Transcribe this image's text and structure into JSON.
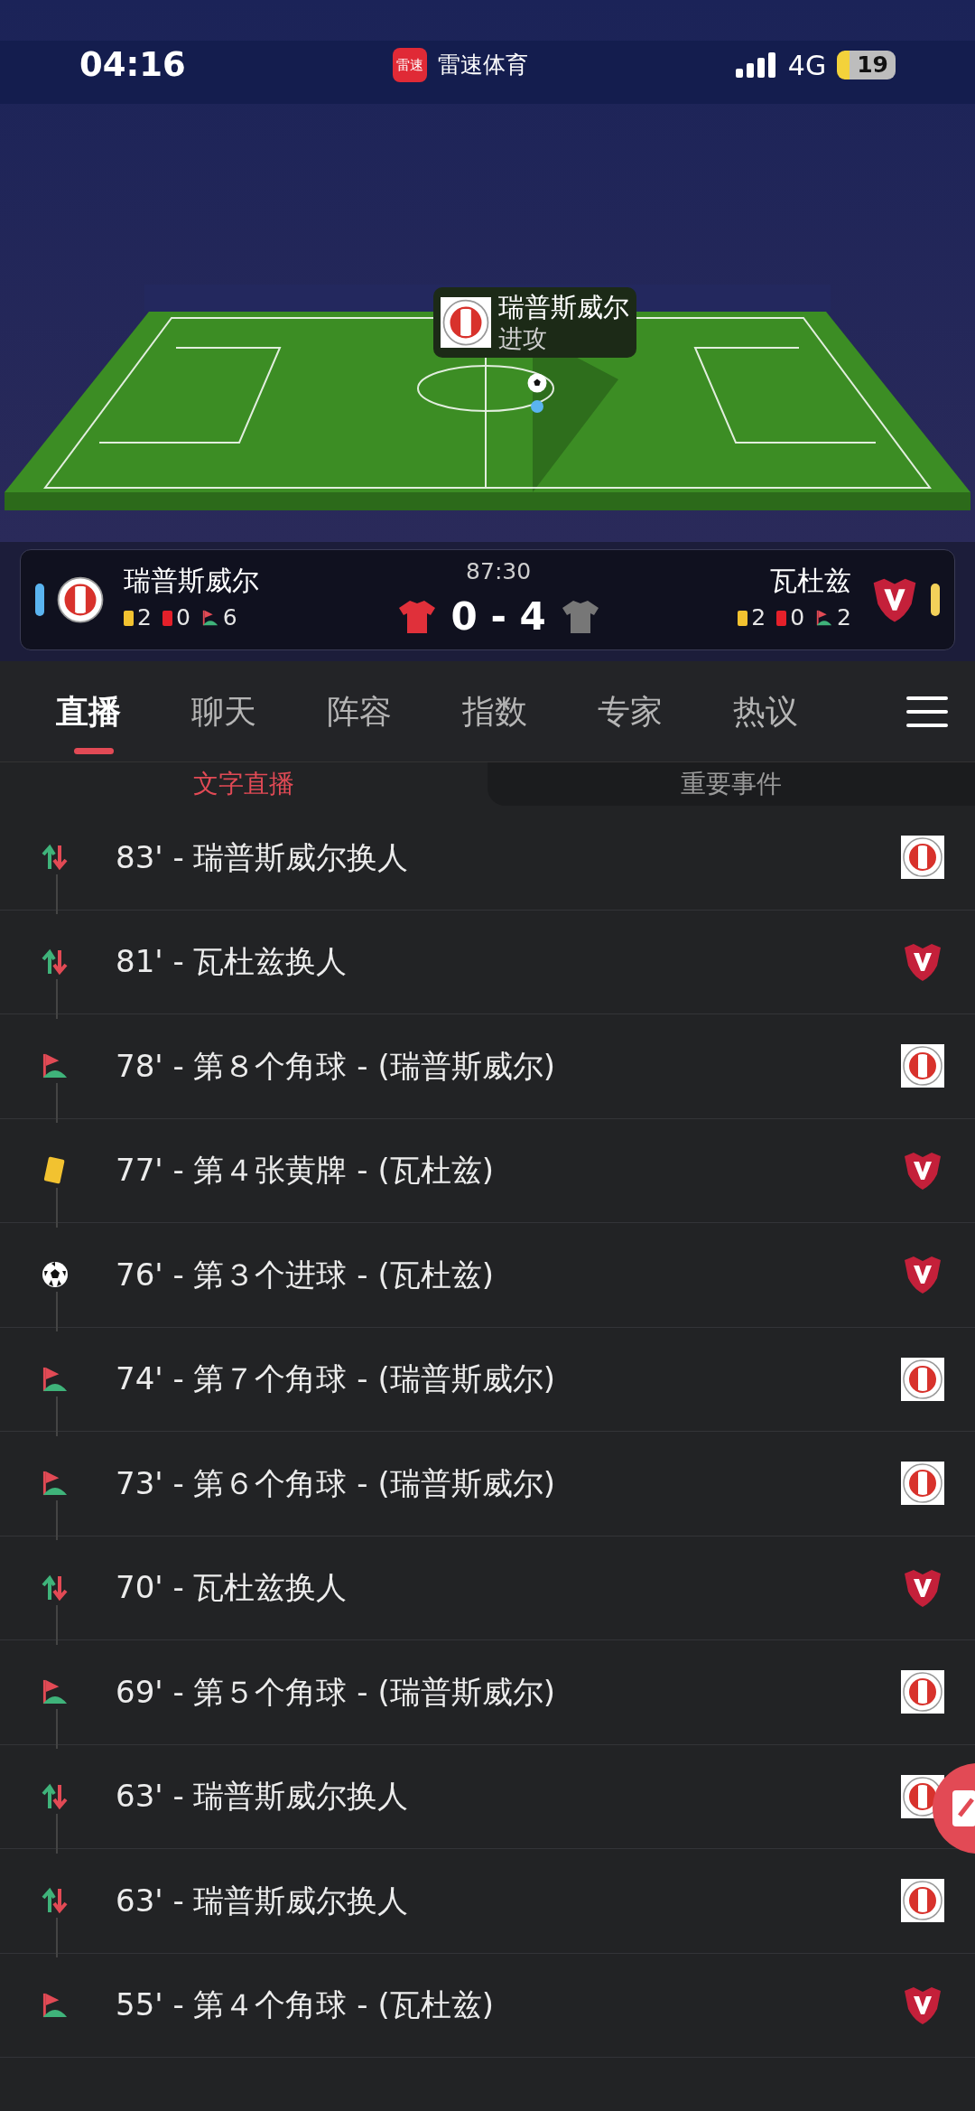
{
  "status_bar": {
    "time": "04:16",
    "app_logo": "雷速",
    "app_name": "雷速体育",
    "network": "4G",
    "battery": "19"
  },
  "pitch_overlay": {
    "team": "瑞普斯威尔",
    "action": "进攻"
  },
  "scoreboard": {
    "clock": "87:30",
    "score": "0 - 4",
    "home": {
      "name": "瑞普斯威尔",
      "color": "#5ab4f0",
      "yellow": "2",
      "red": "0",
      "corners": "6"
    },
    "away": {
      "name": "瓦杜兹",
      "color": "#f3d15a",
      "yellow": "2",
      "red": "0",
      "corners": "2"
    }
  },
  "tabs": [
    {
      "label": "直播",
      "selected": true
    },
    {
      "label": "聊天",
      "selected": false
    },
    {
      "label": "阵容",
      "selected": false
    },
    {
      "label": "指数",
      "selected": false
    },
    {
      "label": "专家",
      "selected": false
    },
    {
      "label": "热议",
      "selected": false
    }
  ],
  "subtabs": [
    {
      "label": "文字直播",
      "selected": true
    },
    {
      "label": "重要事件",
      "selected": false
    }
  ],
  "events": [
    {
      "kind": "sub",
      "text": "83' - 瑞普斯威尔换人",
      "badge": {
        "kind": "home"
      }
    },
    {
      "kind": "sub",
      "text": "81' - 瓦杜兹换人",
      "badge": {
        "kind": "away"
      }
    },
    {
      "kind": "corner",
      "text": "78' - 第８个角球 - (瑞普斯威尔)",
      "badge": {
        "kind": "home"
      }
    },
    {
      "kind": "yellow",
      "text": "77' - 第４张黄牌 - (瓦杜兹)",
      "badge": {
        "kind": "away"
      }
    },
    {
      "kind": "goal",
      "text": "76' - 第３个进球 - (瓦杜兹)",
      "badge": {
        "kind": "away"
      }
    },
    {
      "kind": "corner",
      "text": "74' - 第７个角球 - (瑞普斯威尔)",
      "badge": {
        "kind": "home"
      }
    },
    {
      "kind": "corner",
      "text": "73' - 第６个角球 - (瑞普斯威尔)",
      "badge": {
        "kind": "home"
      }
    },
    {
      "kind": "sub",
      "text": "70' - 瓦杜兹换人",
      "badge": {
        "kind": "away"
      }
    },
    {
      "kind": "corner",
      "text": "69' - 第５个角球 - (瑞普斯威尔)",
      "badge": {
        "kind": "home"
      }
    },
    {
      "kind": "sub",
      "text": "63' - 瑞普斯威尔换人",
      "badge": {
        "kind": "home"
      }
    },
    {
      "kind": "sub",
      "text": "63' - 瑞普斯威尔换人",
      "badge": {
        "kind": "home"
      }
    },
    {
      "kind": "corner",
      "text": "55' - 第４个角球 - (瓦杜兹)",
      "badge": {
        "kind": "away"
      }
    }
  ]
}
